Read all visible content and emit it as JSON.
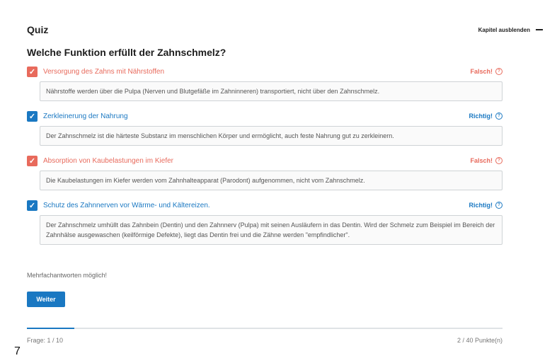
{
  "quiz": {
    "title": "Quiz",
    "hide_chapter_label": "Kapitel ausblenden",
    "question": "Welche Funktion erfüllt der Zahnschmelz?",
    "answers": [
      {
        "label": "Versorgung des Zahns mit Nährstoffen",
        "checked": true,
        "verdict": "Falsch!",
        "status": "wrong",
        "explanation": "Nährstoffe werden über die Pulpa (Nerven und Blutgefäße im Zahninneren) transportiert, nicht über den Zahnschmelz."
      },
      {
        "label": "Zerkleinerung der Nahrung",
        "checked": true,
        "verdict": "Richtig!",
        "status": "right",
        "explanation": "Der Zahnschmelz ist die härteste Substanz im menschlichen Körper und ermöglicht, auch feste Nahrung gut zu zerkleinern."
      },
      {
        "label": "Absorption von Kaubelastungen im Kiefer",
        "checked": true,
        "verdict": "Falsch!",
        "status": "wrong",
        "explanation": "Die Kaubelastungen im Kiefer werden vom Zahnhalteapparat (Parodont) aufgenommen, nicht vom Zahnschmelz."
      },
      {
        "label": "Schutz des Zahnnerven vor Wärme- und Kältereizen.",
        "checked": true,
        "verdict": "Richtig!",
        "status": "right",
        "explanation": "Der Zahnschmelz umhüllt das Zahnbein (Dentin) und den Zahnnerv (Pulpa) mit seinen Ausläufern in das Dentin. Wird der Schmelz zum Beispiel im Bereich der Zahnhälse ausgewaschen (keilförmige Defekte), liegt das Dentin frei und die Zähne werden \"empfindlicher\"."
      }
    ],
    "hint": "Mehrfachantworten möglich!",
    "next_button": "Weiter",
    "progress_fraction": 0.1,
    "question_counter": "Frage: 1 / 10",
    "points": "2 / 40 Punkte(n)"
  },
  "page_number": "7",
  "icons": {
    "checkbox_checked": "check-icon",
    "help": "help-circle-icon"
  },
  "colors": {
    "accent": "#1a78c2",
    "wrong": "#e86a5c"
  }
}
